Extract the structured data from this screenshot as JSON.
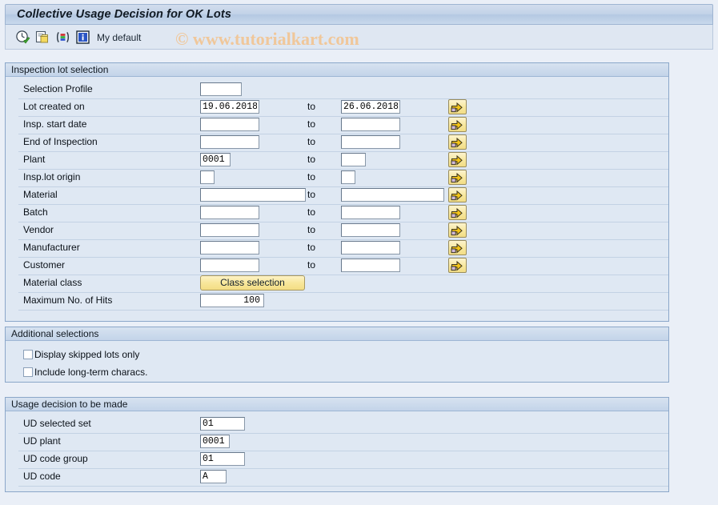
{
  "window": {
    "title": "Collective Usage Decision for OK Lots"
  },
  "toolbar": {
    "icons": [
      {
        "name": "execute-clock-icon"
      },
      {
        "name": "copy-document-icon"
      },
      {
        "name": "color-bars-icon"
      },
      {
        "name": "info-icon"
      }
    ],
    "my_default_label": "My default",
    "watermark": "© www.tutorialkart.com"
  },
  "sections": {
    "inspection_lot_selection": {
      "header": "Inspection lot selection",
      "to_label": "to",
      "rows": [
        {
          "label": "Selection Profile",
          "from": "",
          "to": null,
          "arrow": false
        },
        {
          "label": "Lot created on",
          "from": "19.06.2018",
          "to": "26.06.2018",
          "arrow": true
        },
        {
          "label": "Insp. start date",
          "from": "",
          "to": "",
          "arrow": true
        },
        {
          "label": "End of Inspection",
          "from": "",
          "to": "",
          "arrow": true
        },
        {
          "label": "Plant",
          "from": "0001",
          "to": "",
          "arrow": true
        },
        {
          "label": "Insp.lot origin",
          "from": "",
          "to": "",
          "arrow": true
        },
        {
          "label": "Material",
          "from": "",
          "to": "",
          "arrow": true
        },
        {
          "label": "Batch",
          "from": "",
          "to": "",
          "arrow": true
        },
        {
          "label": "Vendor",
          "from": "",
          "to": "",
          "arrow": true
        },
        {
          "label": "Manufacturer",
          "from": "",
          "to": "",
          "arrow": true
        },
        {
          "label": "Customer",
          "from": "",
          "to": "",
          "arrow": true
        }
      ],
      "material_class": {
        "label": "Material class",
        "button_label": "Class selection"
      },
      "max_hits": {
        "label": "Maximum No. of Hits",
        "value": "100"
      }
    },
    "additional_selections": {
      "header": "Additional selections",
      "checkboxes": [
        {
          "label": "Display skipped lots only",
          "checked": false
        },
        {
          "label": "Include long-term characs.",
          "checked": false
        }
      ]
    },
    "usage_decision": {
      "header": "Usage decision to be made",
      "rows": [
        {
          "label": "UD selected set",
          "value": "01"
        },
        {
          "label": "UD plant",
          "value": "0001"
        },
        {
          "label": "UD code group",
          "value": "01"
        },
        {
          "label": "UD code",
          "value": "A"
        }
      ]
    }
  },
  "colors": {
    "page_bg": "#eaeff7",
    "panel_bg": "#dfe8f3",
    "panel_border": "#8ba7c9",
    "title_bar": "#c2d2e8",
    "accent_yellow": "#f7e79c",
    "watermark": "#f0c79a"
  }
}
